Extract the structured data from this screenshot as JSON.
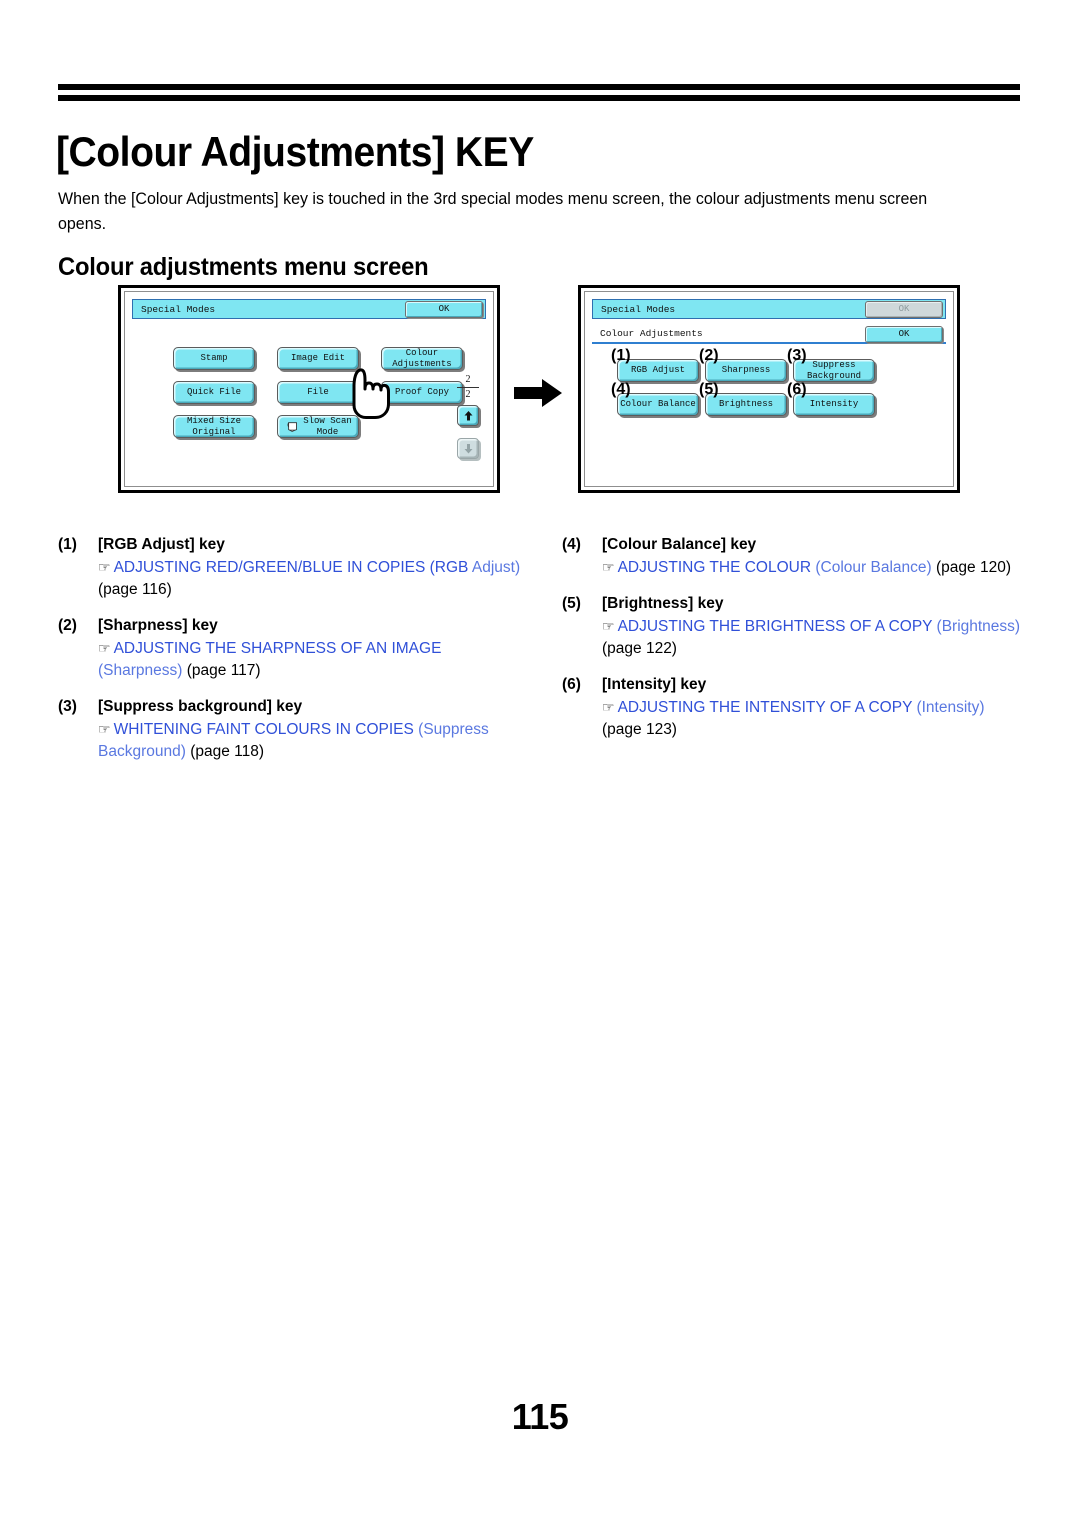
{
  "document": {
    "title": "[Colour Adjustments] KEY",
    "intro": "When the [Colour Adjustments] key is touched in the 3rd special modes menu screen, the colour adjustments menu screen opens.",
    "section_title": "Colour adjustments menu screen",
    "folio": "115"
  },
  "colors": {
    "lcd_key": "#7FE6F2",
    "lcd_key_disabled": "#CFD8DA",
    "titlebar": "#7FE6F2",
    "link_blue": "#3050D8",
    "link_blue_light": "#5A78E0",
    "frame": "#000000"
  },
  "left_screen": {
    "title": "Special Modes",
    "ok_label": "OK",
    "keys": [
      {
        "label": "Stamp",
        "state": "enabled"
      },
      {
        "label": "Image Edit",
        "state": "enabled"
      },
      {
        "label": "Colour\nAdjustments",
        "state": "enabled"
      },
      {
        "label": "Quick File",
        "state": "enabled"
      },
      {
        "label": "File",
        "state": "enabled"
      },
      {
        "label": "Proof Copy",
        "state": "enabled"
      },
      {
        "label": "Mixed Size\nOriginal",
        "state": "enabled"
      },
      {
        "label": "Slow Scan\nMode",
        "state": "enabled"
      }
    ],
    "page_counter": {
      "current": "2",
      "total": "2"
    },
    "scroll_up": {
      "icon": "arrow-up-icon",
      "state": "enabled"
    },
    "scroll_down": {
      "icon": "arrow-down-icon",
      "state": "disabled"
    },
    "cursor": "hand-pointer-cursor"
  },
  "right_screen": {
    "title": "Special Modes",
    "ok_top_label": "OK",
    "ok_top_state": "disabled",
    "subtitle": "Colour Adjustments",
    "ok_sub_label": "OK",
    "ok_sub_state": "enabled",
    "keys": [
      {
        "callout": "(1)",
        "label": "RGB Adjust"
      },
      {
        "callout": "(2)",
        "label": "Sharpness"
      },
      {
        "callout": "(3)",
        "label": "Suppress\nBackground"
      },
      {
        "callout": "(4)",
        "label": "Colour Balance"
      },
      {
        "callout": "(5)",
        "label": "Brightness"
      },
      {
        "callout": "(6)",
        "label": "Intensity"
      }
    ]
  },
  "transition": {
    "icon": "right-arrow-icon"
  },
  "legend": {
    "glyph": "☞",
    "left_column": [
      {
        "num": "(1)",
        "key": "[RGB Adjust] key",
        "ref_main": "ADJUSTING RED/GREEN/BLUE IN COPIES (RGB",
        "ref_sub": "Adjust)",
        "ref_page": "(page 116)"
      },
      {
        "num": "(2)",
        "key": "[Sharpness] key",
        "ref_main": "ADJUSTING THE SHARPNESS OF AN IMAGE",
        "ref_sub": "(Sharpness)",
        "ref_page": "(page 117)"
      },
      {
        "num": "(3)",
        "key": "[Suppress background] key",
        "ref_main": "WHITENING FAINT COLOURS IN COPIES",
        "ref_sub": "(Suppress Background)",
        "ref_page": "(page 118)"
      }
    ],
    "right_column": [
      {
        "num": "(4)",
        "key": "[Colour Balance] key",
        "ref_main": "ADJUSTING THE COLOUR",
        "ref_sub": "(Colour Balance)",
        "ref_page": "(page",
        "ref_page2": "120)"
      },
      {
        "num": "(5)",
        "key": "[Brightness] key",
        "ref_main": "ADJUSTING THE BRIGHTNESS OF A COPY",
        "ref_sub": "(Brightness)",
        "ref_page": "(page 122)"
      },
      {
        "num": "(6)",
        "key": "[Intensity] key",
        "ref_main": "ADJUSTING THE INTENSITY OF A COPY",
        "ref_sub": "(Intensity)",
        "ref_page": "(page 123)"
      }
    ]
  }
}
